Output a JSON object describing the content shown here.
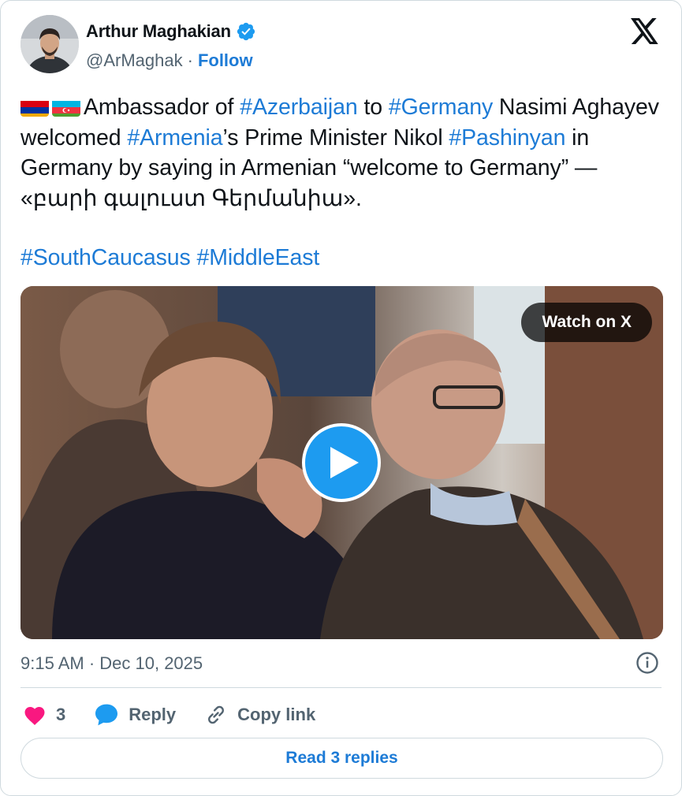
{
  "author": {
    "name": "Arthur Maghakian",
    "handle": "@ArMaghak",
    "separator": "·",
    "follow_label": "Follow",
    "verified": true
  },
  "brand": {
    "logo_icon": "x-logo-icon"
  },
  "tweet": {
    "flags": [
      "armenia-flag-icon",
      "azerbaijan-flag-icon"
    ],
    "segments": [
      {
        "text": "Ambassador of ",
        "tag": false
      },
      {
        "text": "#Azerbaijan",
        "tag": true
      },
      {
        "text": " to ",
        "tag": false
      },
      {
        "text": "#Germany",
        "tag": true
      },
      {
        "text": " Nasimi Aghayev welcomed ",
        "tag": false
      },
      {
        "text": "#Armenia",
        "tag": true
      },
      {
        "text": "’s Prime Minister Nikol ",
        "tag": false
      },
      {
        "text": "#Pashinyan",
        "tag": true
      },
      {
        "text": " in Germany by saying in Armenian “welcome to Germany” — «բարի գալուստ Գերմանիա».",
        "tag": false
      }
    ],
    "hashtags_line": [
      "#SouthCaucasus",
      "#MiddleEast"
    ]
  },
  "media": {
    "watch_label": "Watch on X",
    "play_icon": "play-icon"
  },
  "meta": {
    "time": "9:15 AM",
    "separator": "·",
    "date": "Dec 10, 2025",
    "timestamp_text": "9:15 AM · Dec 10, 2025"
  },
  "actions": {
    "like_count": "3",
    "reply_label": "Reply",
    "copy_label": "Copy link"
  },
  "replies_button": "Read 3 replies",
  "colors": {
    "link": "#1d7bd6",
    "like": "#f91880",
    "reply": "#1d9bf0",
    "muted": "#536471",
    "border": "#cfd9de"
  }
}
